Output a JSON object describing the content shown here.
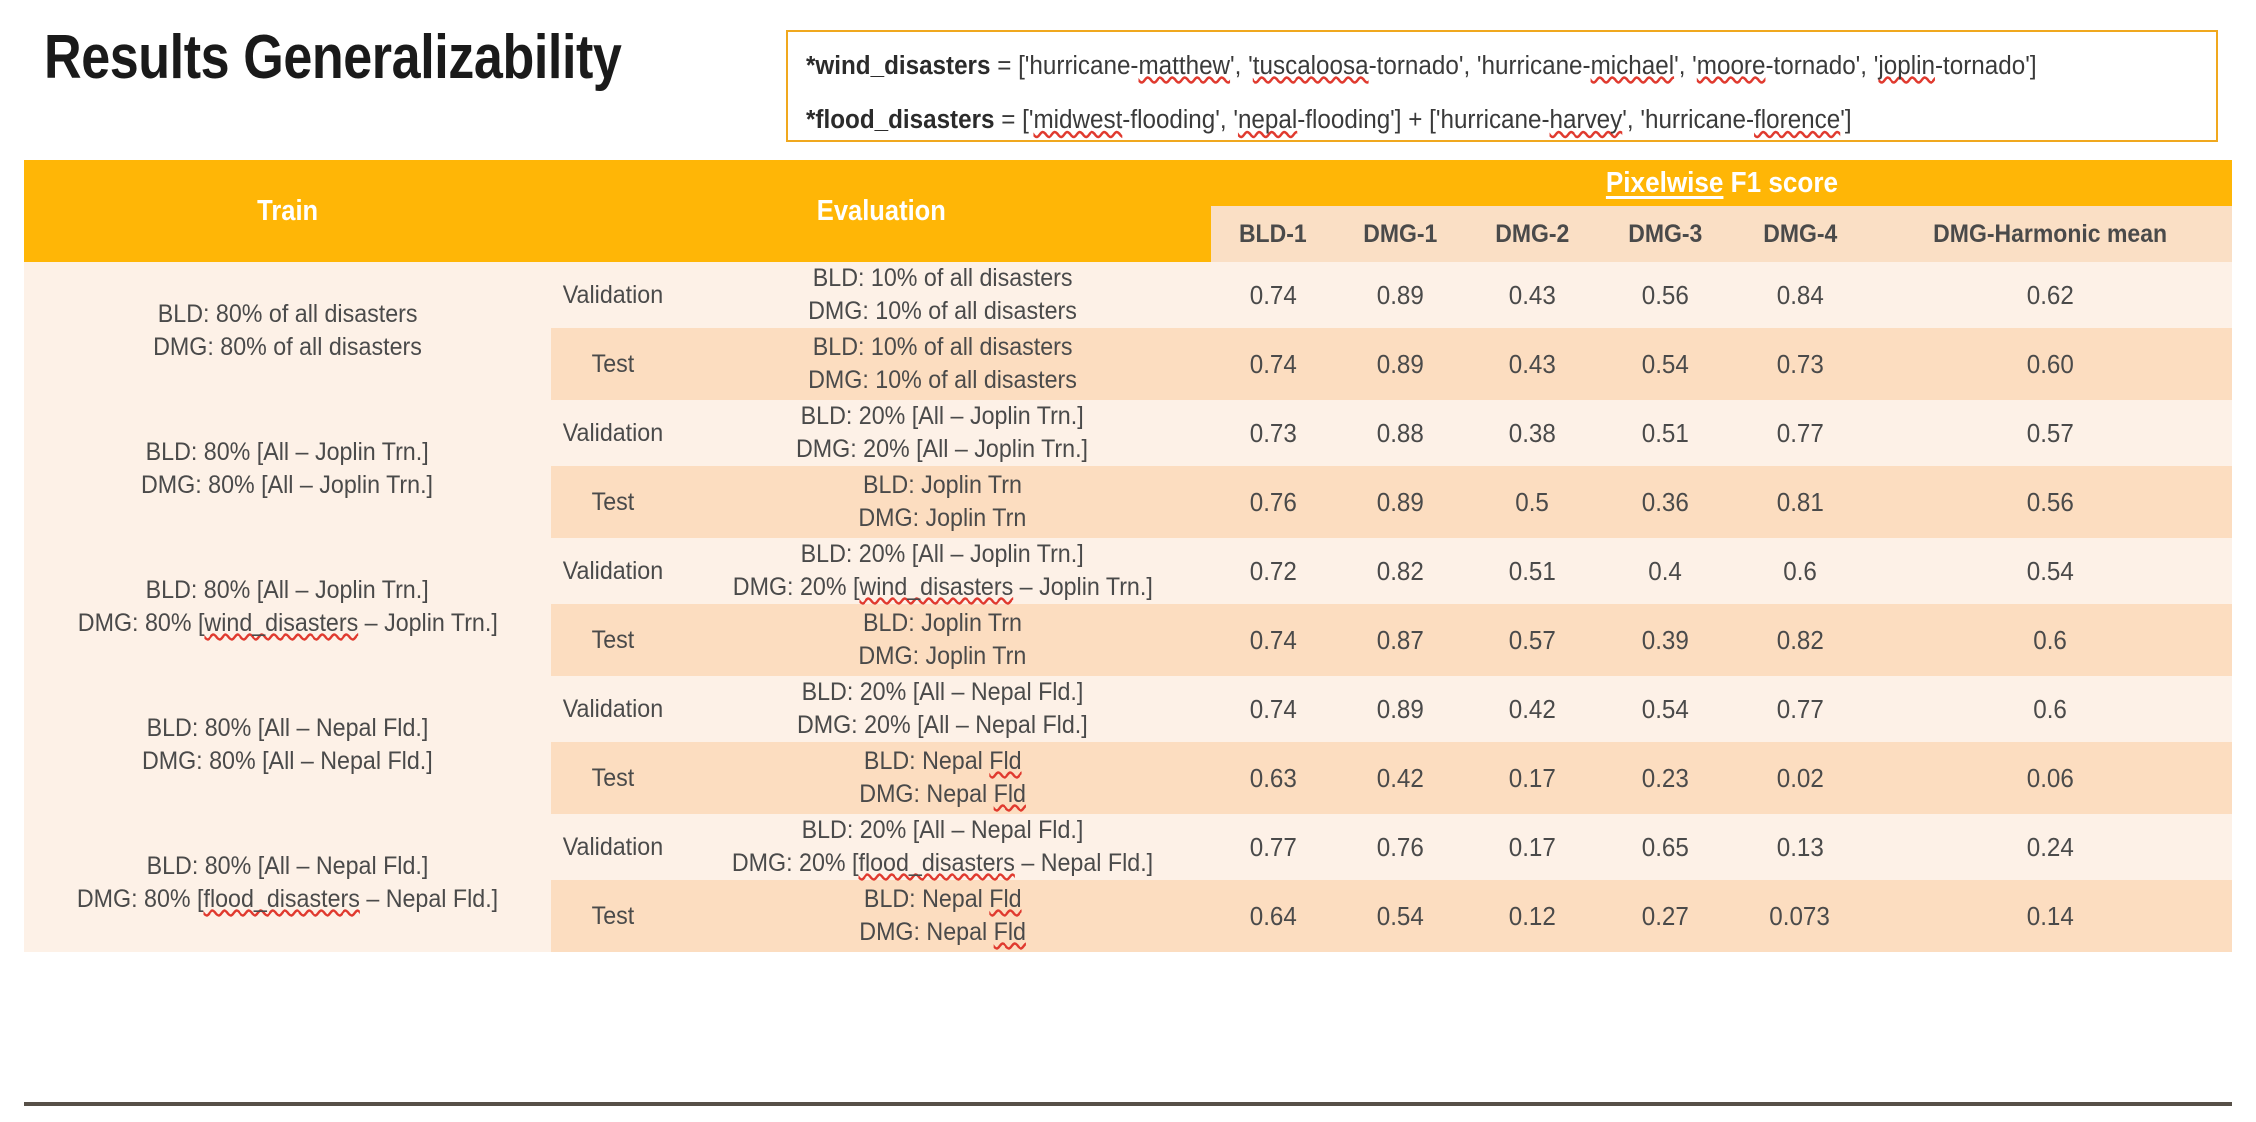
{
  "slide": {
    "title": "Results Generalizability"
  },
  "legend": {
    "wind_key": "*wind_disasters",
    "wind_eq": " = ['hurricane-",
    "wind_line_plain": "*wind_disasters = ['hurricane-matthew', 'tuscaloosa-tornado', 'hurricane-michael', 'moore-tornado', 'joplin-tornado']",
    "flood_line_plain": "*flood_disasters = ['midwest-flooding', 'nepal-flooding'] + ['hurricane-harvey', 'hurricane-florence']",
    "wind_parts": {
      "p1": " = ['hurricane-",
      "sp1": "matthew",
      "p2": "', '",
      "sp2": "tuscaloosa",
      "p3": "-tornado', 'hurricane-",
      "sp3": "michael",
      "p4": "', '",
      "sp4": "moore",
      "p5": "-tornado', '",
      "sp5": "joplin",
      "p6": "-tornado']"
    },
    "flood_key": "*flood_disasters",
    "flood_parts": {
      "p1": " = ['",
      "sp1": "midwest",
      "p2": "-flooding', '",
      "sp2": "nepal",
      "p3": "-flooding'] + ['hurricane-",
      "sp3": "harvey",
      "p4": "', 'hurricane-",
      "sp4": "florence",
      "p5": "']"
    }
  },
  "table": {
    "header": {
      "train": "Train",
      "evaluation": "Evaluation",
      "pixelwise_underlined": "Pixelwise",
      "pixelwise_rest": " F1 score",
      "metric_columns": [
        "BLD-1",
        "DMG-1",
        "DMG-2",
        "DMG-3",
        "DMG-4",
        "DMG-Harmonic mean"
      ]
    },
    "groups": [
      {
        "train_line1": "BLD: 80% of all disasters",
        "train_line2": "DMG: 80% of all disasters",
        "rows": [
          {
            "split": "Validation",
            "eval_line1": "BLD: 10% of all disasters",
            "eval_line2": "DMG: 10% of all disasters",
            "values": [
              "0.74",
              "0.89",
              "0.43",
              "0.56",
              "0.84",
              "0.62"
            ]
          },
          {
            "split": "Test",
            "eval_line1": "BLD: 10% of all disasters",
            "eval_line2": "DMG: 10% of all disasters",
            "values": [
              "0.74",
              "0.89",
              "0.43",
              "0.54",
              "0.73",
              "0.60"
            ]
          }
        ]
      },
      {
        "train_line1": "BLD: 80% [All – Joplin Trn.]",
        "train_line2": "DMG: 80% [All – Joplin Trn.]",
        "rows": [
          {
            "split": "Validation",
            "eval_line1": "BLD: 20% [All – Joplin Trn.]",
            "eval_line2": "DMG: 20% [All – Joplin Trn.]",
            "values": [
              "0.73",
              "0.88",
              "0.38",
              "0.51",
              "0.77",
              "0.57"
            ]
          },
          {
            "split": "Test",
            "eval_line1": "BLD: Joplin Trn",
            "eval_line2": "DMG: Joplin Trn",
            "values": [
              "0.76",
              "0.89",
              "0.5",
              "0.36",
              "0.81",
              "0.56"
            ]
          }
        ]
      },
      {
        "train_line1": "BLD: 80% [All – Joplin Trn.]",
        "train_line2_pre": "DMG: 80% [",
        "train_line2_sp": "wind_disasters",
        "train_line2_post": " – Joplin Trn.]",
        "rows": [
          {
            "split": "Validation",
            "eval_line1": "BLD: 20% [All – Joplin Trn.]",
            "eval_line2_pre": "DMG: 20% [",
            "eval_line2_sp": "wind_disasters",
            "eval_line2_post": " – Joplin Trn.]",
            "values": [
              "0.72",
              "0.82",
              "0.51",
              "0.4",
              "0.6",
              "0.54"
            ]
          },
          {
            "split": "Test",
            "eval_line1": "BLD: Joplin Trn",
            "eval_line2": "DMG: Joplin Trn",
            "values": [
              "0.74",
              "0.87",
              "0.57",
              "0.39",
              "0.82",
              "0.6"
            ]
          }
        ]
      },
      {
        "train_line1": "BLD: 80% [All – Nepal Fld.]",
        "train_line2": "DMG: 80% [All – Nepal Fld.]",
        "rows": [
          {
            "split": "Validation",
            "eval_line1": "BLD: 20% [All – Nepal Fld.]",
            "eval_line2": "DMG: 20% [All – Nepal Fld.]",
            "values": [
              "0.74",
              "0.89",
              "0.42",
              "0.54",
              "0.77",
              "0.6"
            ]
          },
          {
            "split": "Test",
            "eval_line1_pre": "BLD: Nepal ",
            "eval_line1_sp": "Fld",
            "eval_line2_pre": "DMG: Nepal ",
            "eval_line2_sp": "Fld",
            "values": [
              "0.63",
              "0.42",
              "0.17",
              "0.23",
              "0.02",
              "0.06"
            ]
          }
        ]
      },
      {
        "train_line1": "BLD: 80% [All – Nepal Fld.]",
        "train_line2_pre": "DMG: 80% [",
        "train_line2_sp": "flood_disasters",
        "train_line2_post": " – Nepal Fld.]",
        "rows": [
          {
            "split": "Validation",
            "eval_line1": "BLD: 20% [All – Nepal Fld.]",
            "eval_line2_pre": "DMG: 20% [",
            "eval_line2_sp": "flood_disasters",
            "eval_line2_post": " – Nepal Fld.]",
            "values": [
              "0.77",
              "0.76",
              "0.17",
              "0.65",
              "0.13",
              "0.24"
            ]
          },
          {
            "split": "Test",
            "eval_line1_pre": "BLD: Nepal ",
            "eval_line1_sp": "Fld",
            "eval_line2_pre": "DMG: Nepal ",
            "eval_line2_sp": "Fld",
            "values": [
              "0.64",
              "0.54",
              "0.12",
              "0.27",
              "0.073",
              "0.14"
            ]
          }
        ]
      }
    ]
  },
  "colors": {
    "header_orange": "#FFB606",
    "subheader_peach": "#FADFC5",
    "row_validation": "#FDF1E7",
    "row_test": "#FCDDC0",
    "group_separator": "#575048",
    "legend_border": "#F0A81E",
    "spellcheck_red": "#E03A2F"
  }
}
